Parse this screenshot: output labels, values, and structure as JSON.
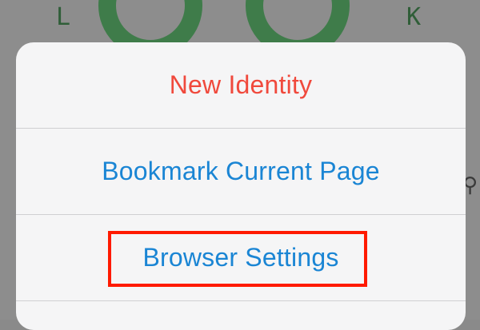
{
  "background_logo": {
    "letter_left": "L",
    "letter_right": "K"
  },
  "menu": {
    "items": [
      {
        "label": "New Identity",
        "color": "#f0493c"
      },
      {
        "label": "Bookmark Current Page",
        "color": "#1a85d4"
      },
      {
        "label": "Browser Settings",
        "color": "#1a85d4"
      }
    ]
  },
  "highlight": {
    "color": "#ff1a00",
    "target": "Browser Settings"
  }
}
